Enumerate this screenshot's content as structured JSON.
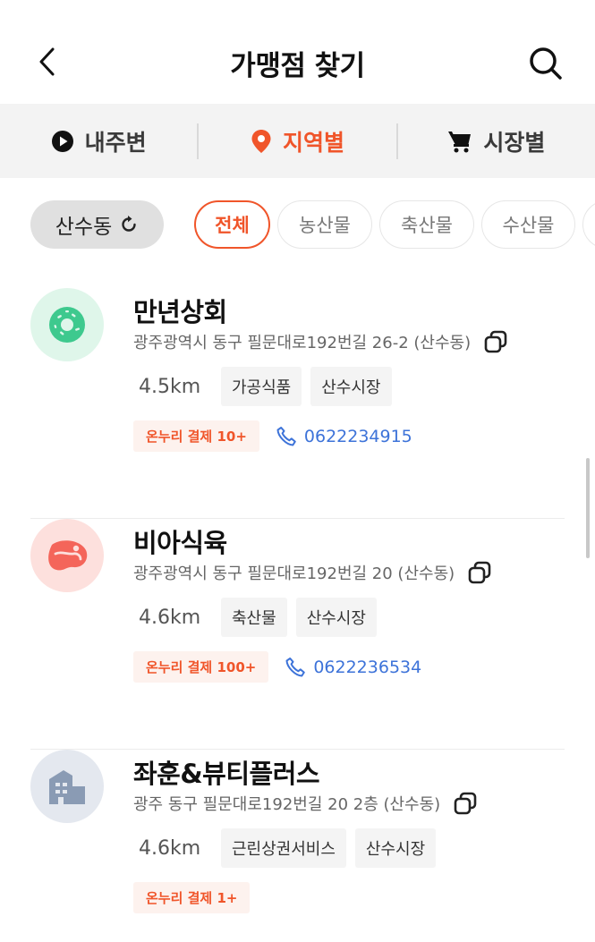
{
  "header": {
    "title": "가맹점 찾기",
    "back_icon": "chevron-left-icon",
    "search_icon": "search-icon"
  },
  "tabs": [
    {
      "label": "내주변",
      "icon": "play-circle-icon",
      "active": false
    },
    {
      "label": "지역별",
      "icon": "location-pin-icon",
      "active": true
    },
    {
      "label": "시장별",
      "icon": "cart-icon",
      "active": false
    }
  ],
  "filters": {
    "region": "산수동",
    "region_icon": "refresh-icon",
    "categories": [
      "전체",
      "농산물",
      "축산물",
      "수산물"
    ],
    "selected": "전체"
  },
  "stores": [
    {
      "name": "만년상회",
      "address": "광주광역시 동구 필문대로192번길 26-2 (산수동)",
      "distance": "4.5km",
      "tags": [
        "가공식품",
        "산수시장"
      ],
      "badge": "온누리 결제 10+",
      "phone": "0622234915",
      "icon": "donut-icon",
      "color": "#3ec98e"
    },
    {
      "name": "비아식육",
      "address": "광주광역시 동구 필문대로192번길 20 (산수동)",
      "distance": "4.6km",
      "tags": [
        "축산물",
        "산수시장"
      ],
      "badge": "온누리 결제 100+",
      "phone": "0622236534",
      "icon": "meat-icon",
      "color": "#f4655a"
    },
    {
      "name": "좌훈&뷰티플러스",
      "address": "광주 동구 필문대로192번길 20 2층 (산수동)",
      "distance": "4.6km",
      "tags": [
        "근린상권서비스",
        "산수시장"
      ],
      "badge": "온누리 결제 1+",
      "phone": "",
      "icon": "building-icon",
      "color": "#8a9bb4"
    }
  ],
  "colors": {
    "accent": "#f0552a",
    "link": "#3d73d9",
    "badge_bg": "#fdf2ee"
  }
}
